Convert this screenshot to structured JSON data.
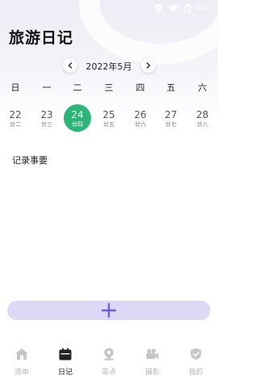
{
  "status": {
    "time": "10:1"
  },
  "title": "旅游日记",
  "calendar": {
    "month_label": "2022年5月",
    "weekdays": [
      "日",
      "一",
      "二",
      "三",
      "四",
      "五",
      "六"
    ],
    "dates": [
      {
        "day": "22",
        "lunar": "廿二"
      },
      {
        "day": "23",
        "lunar": "廿三"
      },
      {
        "day": "24",
        "lunar": "廿四"
      },
      {
        "day": "25",
        "lunar": "廿五"
      },
      {
        "day": "26",
        "lunar": "廿六"
      },
      {
        "day": "27",
        "lunar": "廿七"
      },
      {
        "day": "28",
        "lunar": "廿八"
      }
    ],
    "selected_day": "24"
  },
  "section": {
    "label": "记录事要"
  },
  "tabs": [
    {
      "label": "清单",
      "icon": "home-icon",
      "active": false
    },
    {
      "label": "日记",
      "icon": "calendar-icon",
      "active": true
    },
    {
      "label": "景点",
      "icon": "location-pin-icon",
      "active": false
    },
    {
      "label": "摄影",
      "icon": "camera-icon",
      "active": false
    },
    {
      "label": "我的",
      "icon": "profile-icon",
      "active": false
    }
  ],
  "colors": {
    "accent_green": "#2db477",
    "add_bar_bg": "#dcd9f6",
    "plus_color": "#6b60d6",
    "tab_inactive": "#b8b8b8",
    "tab_active": "#222222"
  }
}
